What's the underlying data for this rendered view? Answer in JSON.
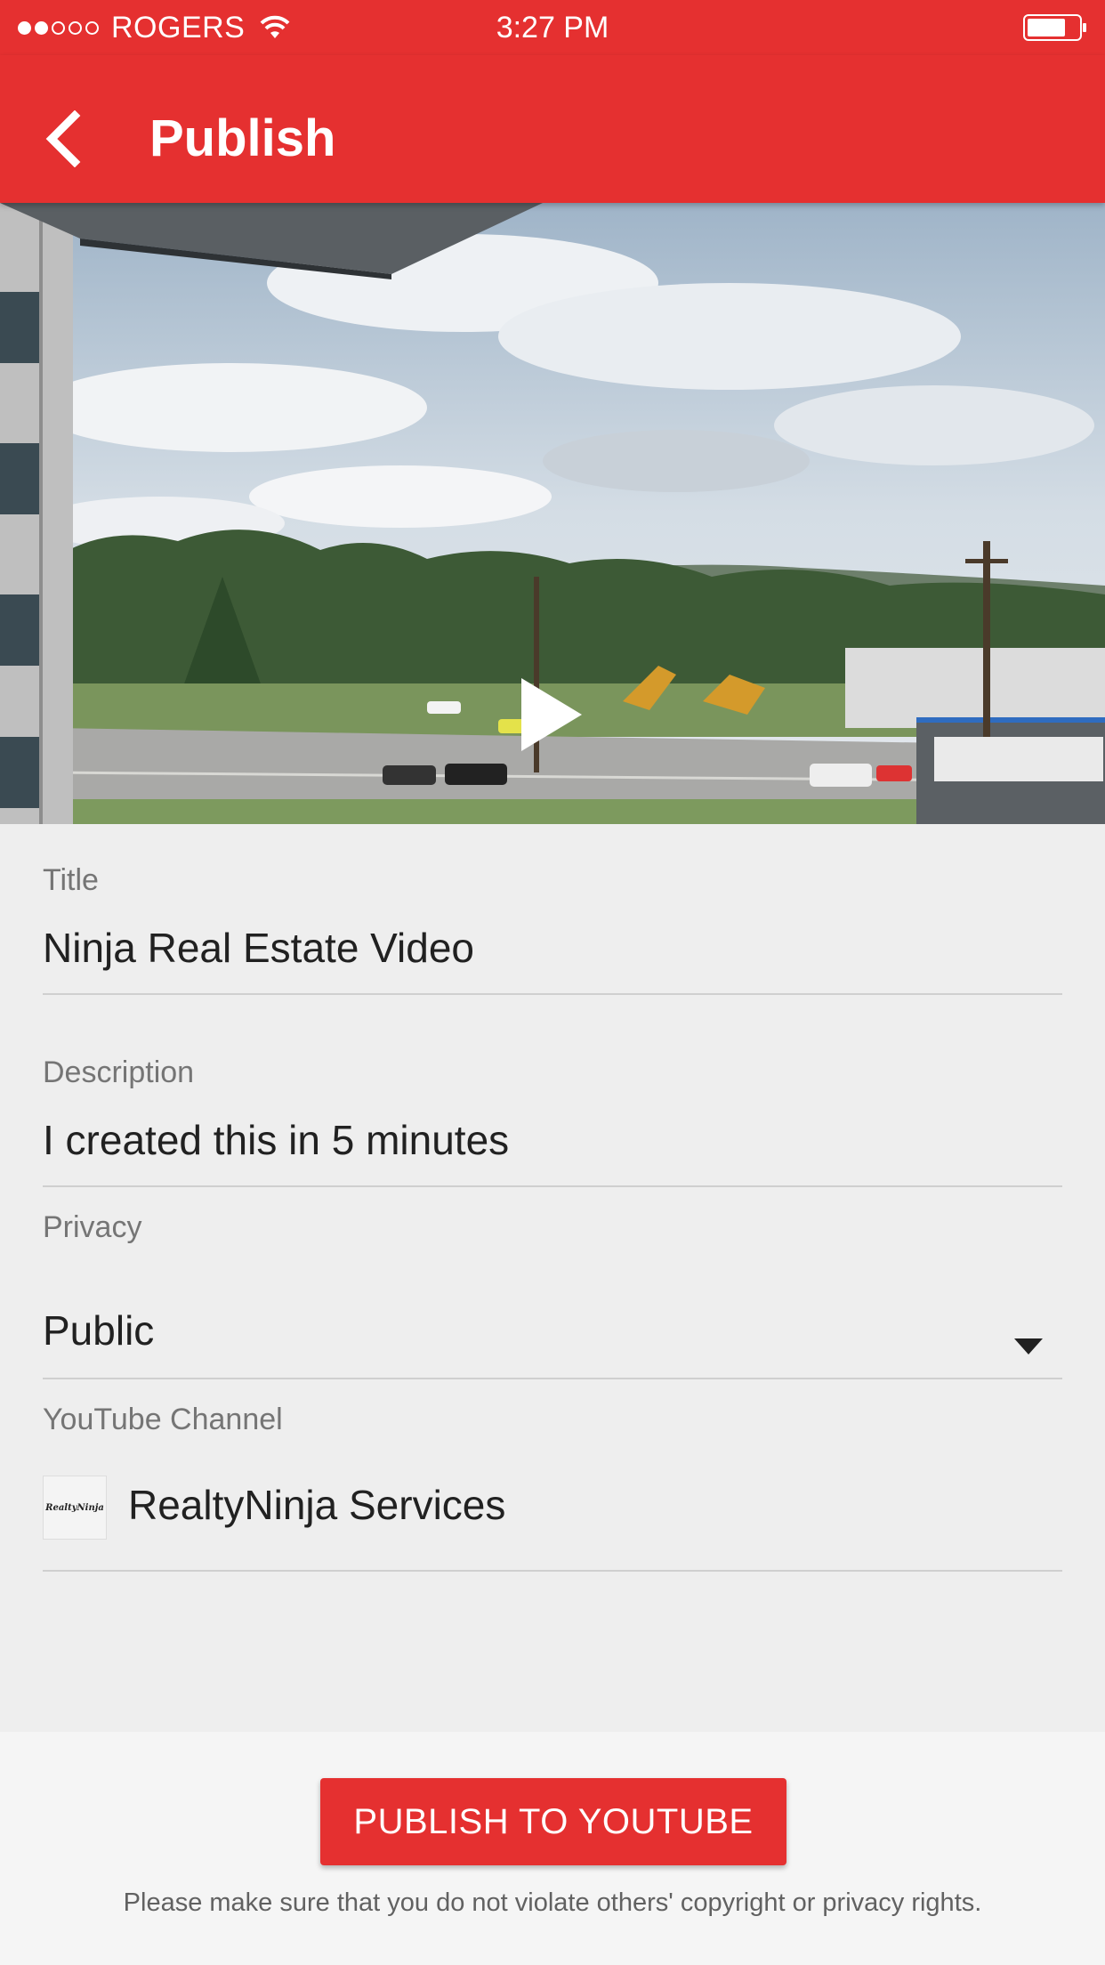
{
  "status_bar": {
    "carrier": "ROGERS",
    "time": "3:27 PM",
    "signal_bars_filled": 2,
    "signal_bars_total": 5,
    "battery_level": 0.75
  },
  "app_bar": {
    "back_icon": "chevron-left-icon",
    "title": "Publish"
  },
  "video": {
    "play_icon": "play-icon"
  },
  "form": {
    "title_label": "Title",
    "title_value": "Ninja Real Estate Video",
    "description_label": "Description",
    "description_value": "I created this in 5 minutes",
    "privacy_label": "Privacy",
    "privacy_value": "Public",
    "channel_label": "YouTube Channel",
    "channel_logo_text": "RealtyNinja",
    "channel_name": "RealtyNinja Services"
  },
  "footer": {
    "publish_button": "PUBLISH TO YOUTUBE",
    "disclaimer": "Please make sure that you do not violate others' copyright or privacy rights."
  },
  "colors": {
    "brand_red": "#e53030",
    "background": "#eeeeee"
  }
}
